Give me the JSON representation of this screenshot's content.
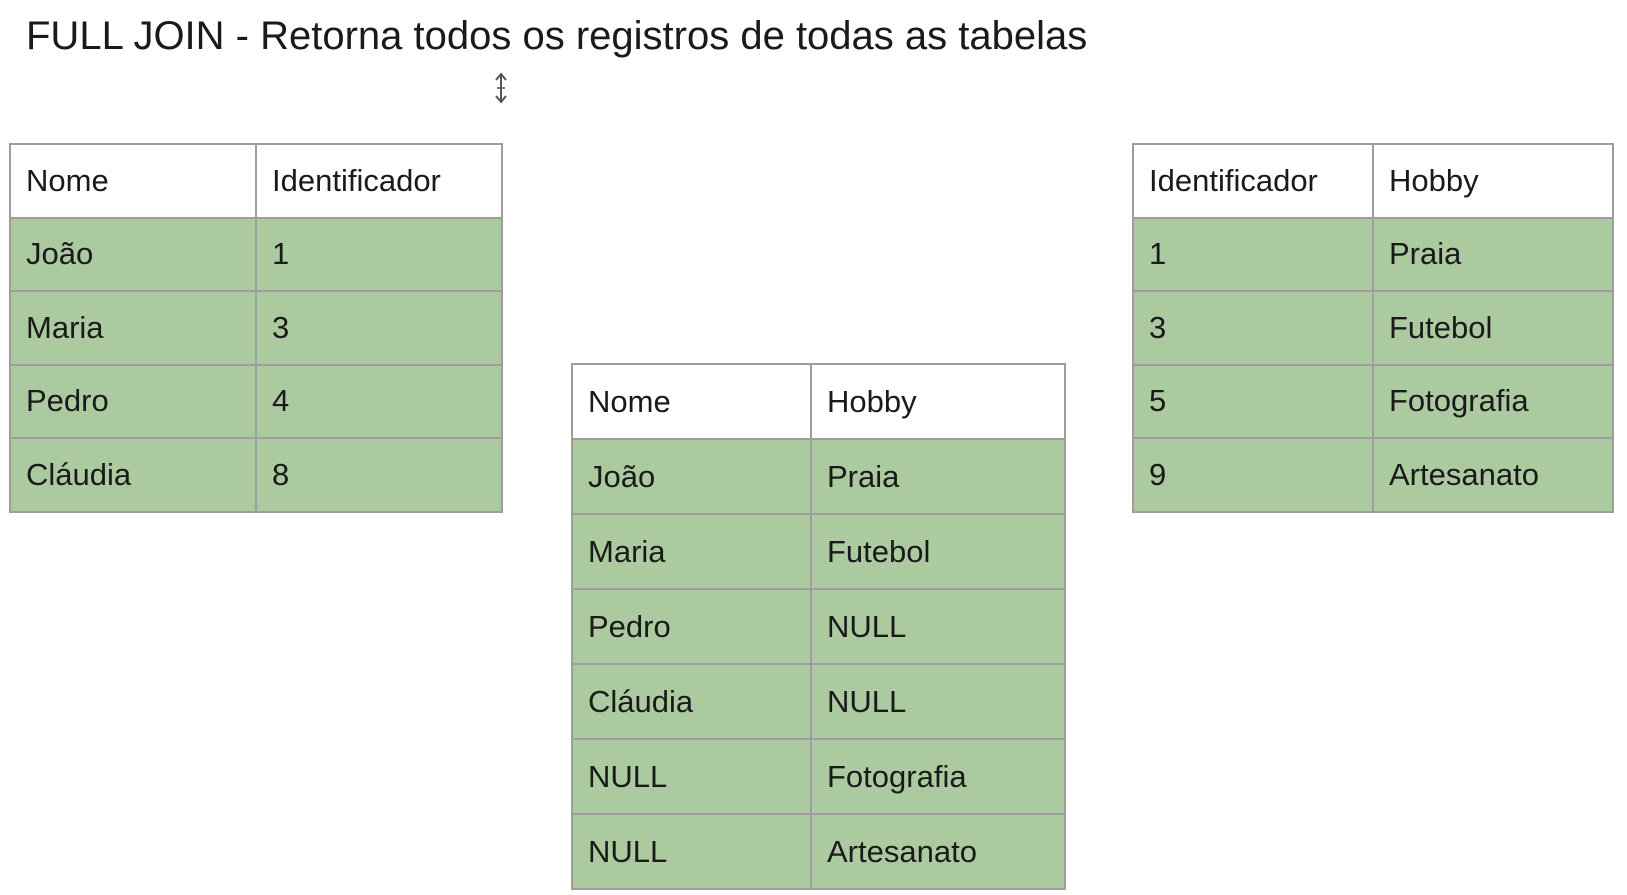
{
  "title": "FULL JOIN - Retorna todos os registros de todas as tabelas",
  "left_table": {
    "headers": [
      "Nome",
      "Identificador"
    ],
    "rows": [
      [
        "João",
        "1"
      ],
      [
        "Maria",
        "3"
      ],
      [
        "Pedro",
        "4"
      ],
      [
        "Cláudia",
        "8"
      ]
    ]
  },
  "right_table": {
    "headers": [
      "Identificador",
      "Hobby"
    ],
    "rows": [
      [
        "1",
        "Praia"
      ],
      [
        "3",
        "Futebol"
      ],
      [
        "5",
        "Fotografia"
      ],
      [
        "9",
        "Artesanato"
      ]
    ]
  },
  "result_table": {
    "headers": [
      "Nome",
      "Hobby"
    ],
    "rows": [
      [
        "João",
        "Praia"
      ],
      [
        "Maria",
        "Futebol"
      ],
      [
        "Pedro",
        "NULL"
      ],
      [
        "Cláudia",
        "NULL"
      ],
      [
        "NULL",
        "Fotografia"
      ],
      [
        "NULL",
        "Artesanato"
      ]
    ]
  },
  "colors": {
    "row_fill": "#abca9f",
    "border": "#9e9e9e",
    "header_fill": "#ffffff"
  },
  "icons": {
    "cursor": "text-cursor-icon"
  }
}
